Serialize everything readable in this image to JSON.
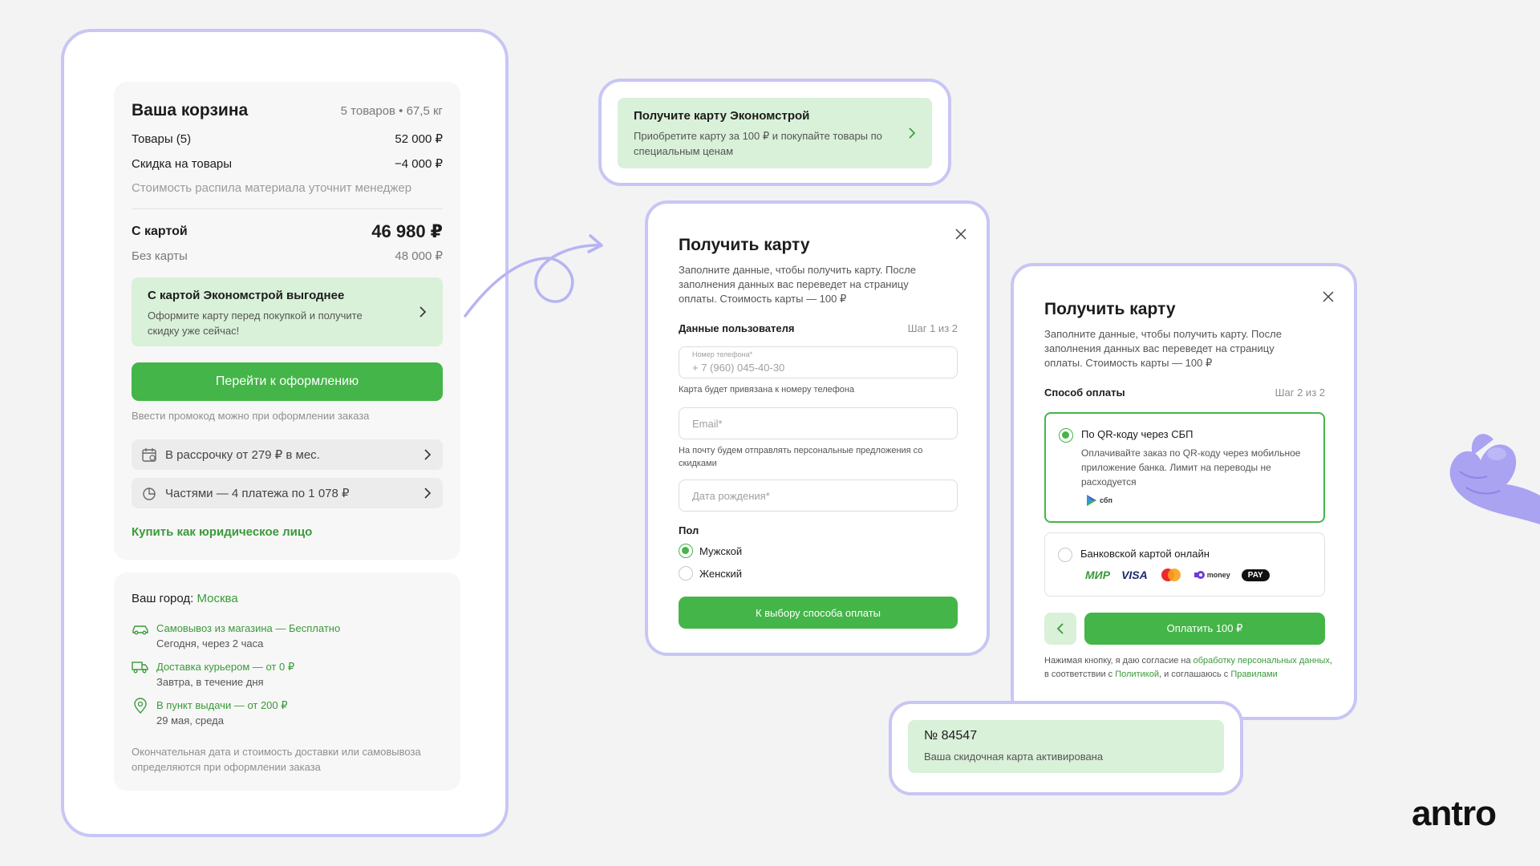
{
  "cart": {
    "title": "Ваша корзина",
    "meta": "5 товаров • 67,5 кг",
    "items_label": "Товары (5)",
    "items_value": "52 000 ₽",
    "discount_label": "Скидка на товары",
    "discount_value": "−4 000 ₽",
    "cut_note": "Стоимость распила материала уточнит менеджер",
    "with_card_label": "С картой",
    "with_card_value": "46 980 ₽",
    "without_card_label": "Без карты",
    "without_card_value": "48 000 ₽",
    "promo_title": "С картой Экономстрой выгоднее",
    "promo_text": "Оформите карту перед покупкой и получите скидку уже сейчас!",
    "checkout_button": "Перейти к оформлению",
    "promo_code_note": "Ввести промокод можно при оформлении заказа",
    "installment_label": "В рассрочку от 279 ₽ в мес.",
    "parts_label": "Частями — 4 платежа по 1 078 ₽",
    "legal_link": "Купить как юридическое лицо"
  },
  "delivery": {
    "city_label": "Ваш город:",
    "city_value": "Москва",
    "options": [
      {
        "title": "Самовывоз из магазина — Бесплатно",
        "sub": "Сегодня, через 2 часа"
      },
      {
        "title": "Доставка курьером — от 0 ₽",
        "sub": "Завтра, в течение дня"
      },
      {
        "title": "В пункт выдачи — от 200 ₽",
        "sub": "29 мая, среда"
      }
    ],
    "note": "Окончательная дата и стоимость доставки или самовывоза определяются при оформлении заказа"
  },
  "banner": {
    "title": "Получите карту Экономстрой",
    "text": "Приобретите карту за 100 ₽ и покупайте товары по специальным ценам"
  },
  "modal1": {
    "title": "Получить карту",
    "desc": "Заполните данные, чтобы получить карту. После заполнения данных вас переведет на страницу оплаты. Стоимость карты — 100 ₽",
    "section": "Данные пользователя",
    "step": "Шаг 1 из 2",
    "phone_label": "Номер телефона*",
    "phone_placeholder": "+ 7 (960) 045-40-30",
    "phone_hint": "Карта будет привязана к номеру телефона",
    "email_placeholder": "Email*",
    "email_hint": "На почту будем отправлять персональные предложения со скидками",
    "birth_placeholder": "Дата рождения*",
    "gender_label": "Пол",
    "gender_male": "Мужской",
    "gender_female": "Женский",
    "submit": "К выбору способа оплаты"
  },
  "modal2": {
    "title": "Получить карту",
    "desc": "Заполните данные, чтобы получить карту. После заполнения данных вас переведет на страницу оплаты. Стоимость карты — 100 ₽",
    "section": "Способ оплаты",
    "step": "Шаг 2 из 2",
    "sbp_title": "По QR-коду через СБП",
    "sbp_text": "Оплачивайте заказ по QR-коду через мобильное приложение банка. Лимит на переводы не расходуется",
    "sbp_logo": "сбп",
    "card_title": "Банковской картой онлайн",
    "card_logos": [
      "МИР",
      "VISA",
      "mastercard",
      "money",
      "PAY"
    ],
    "pay_button": "Оплатить 100 ₽",
    "consent_1": "Нажимая кнопку, я даю согласие на ",
    "consent_link1": "обработку персональных данных",
    "consent_2": ", в соответствии с ",
    "consent_link2": "Политикой",
    "consent_3": ", и соглашаюсь с ",
    "consent_link3": "Правилами"
  },
  "activated": {
    "number": "№ 84547",
    "text": "Ваша скидочная карта активирована"
  },
  "brand": {
    "logo": "antro"
  },
  "colors": {
    "accent": "#44b548",
    "frame": "#c7c6f4",
    "promo_bg": "#d9f0d9"
  }
}
